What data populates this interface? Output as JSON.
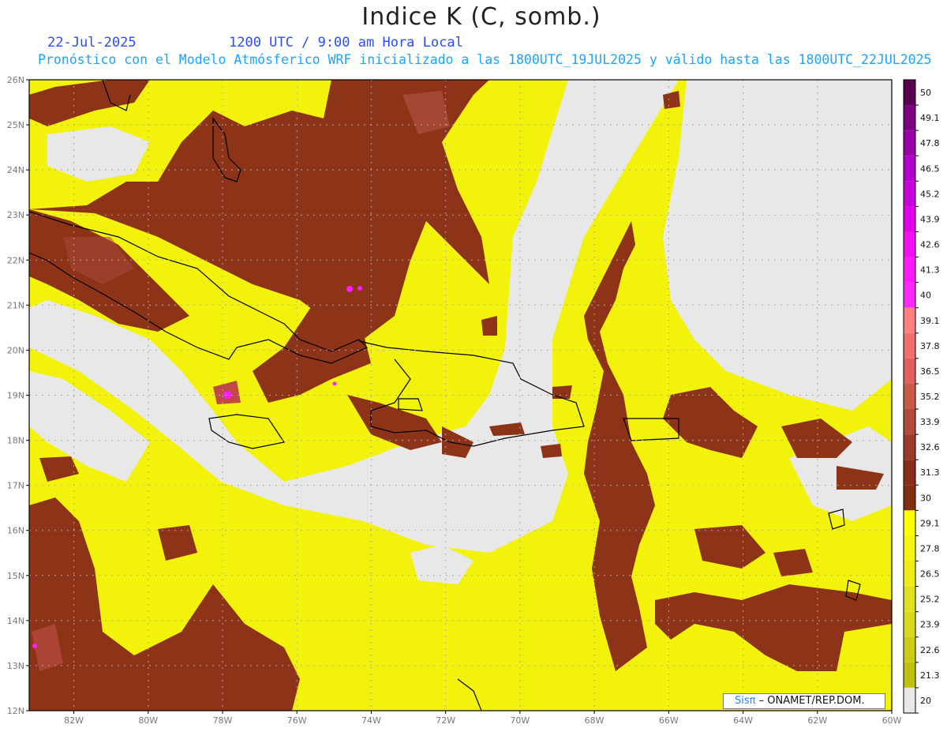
{
  "header": {
    "title": "Indice K (C, somb.)",
    "date": "22-Jul-2025",
    "time": "1200 UTC / 9:00 am Hora Local",
    "description": "Pronóstico con el Modelo Atmósferico WRF inicializado a las 1800UTC_19JUL2025 y válido hasta las  1800UTC_22JUL2025"
  },
  "map": {
    "lat_labels": [
      "12N",
      "13N",
      "14N",
      "15N",
      "16N",
      "17N",
      "18N",
      "19N",
      "20N",
      "21N",
      "22N",
      "23N",
      "24N",
      "25N",
      "26N"
    ],
    "lon_labels": [
      "82W",
      "80W",
      "78W",
      "76W",
      "74W",
      "72W",
      "70W",
      "68W",
      "66W",
      "64W",
      "62W",
      "60W"
    ],
    "lat_range": [
      12,
      26
    ],
    "lon_range": [
      -83.2,
      -60
    ],
    "grid": "dotted",
    "colors": {
      "no_data": "#e8e8e8",
      "low": "#f2f20a",
      "high": "#8c3318",
      "coast": "#000000"
    }
  },
  "colorbar": {
    "labels": [
      "50",
      "49.1",
      "47.8",
      "46.5",
      "45.2",
      "43.9",
      "42.6",
      "41.3",
      "40",
      "39.1",
      "37.8",
      "36.5",
      "35.2",
      "33.9",
      "32.6",
      "31.3",
      "30",
      "29.1",
      "27.8",
      "26.5",
      "25.2",
      "23.9",
      "22.6",
      "21.3",
      "20"
    ],
    "colors": [
      "#5a0050",
      "#7a0080",
      "#9800a8",
      "#b000c8",
      "#c800d8",
      "#e000e8",
      "#f010f0",
      "#ff1aff",
      "#ff2aff",
      "#ff8080",
      "#f07070",
      "#e06060",
      "#c85a4a",
      "#b04a3a",
      "#9a3a2a",
      "#8a2e1a",
      "#803010",
      "#ffff00",
      "#f5f510",
      "#ecec18",
      "#e0e020",
      "#d8d820",
      "#cccc18",
      "#c0c010",
      "#e8e8e8"
    ]
  },
  "footer": {
    "sis": "Sisπ",
    "org": "– ONAMET/REP.DOM."
  }
}
